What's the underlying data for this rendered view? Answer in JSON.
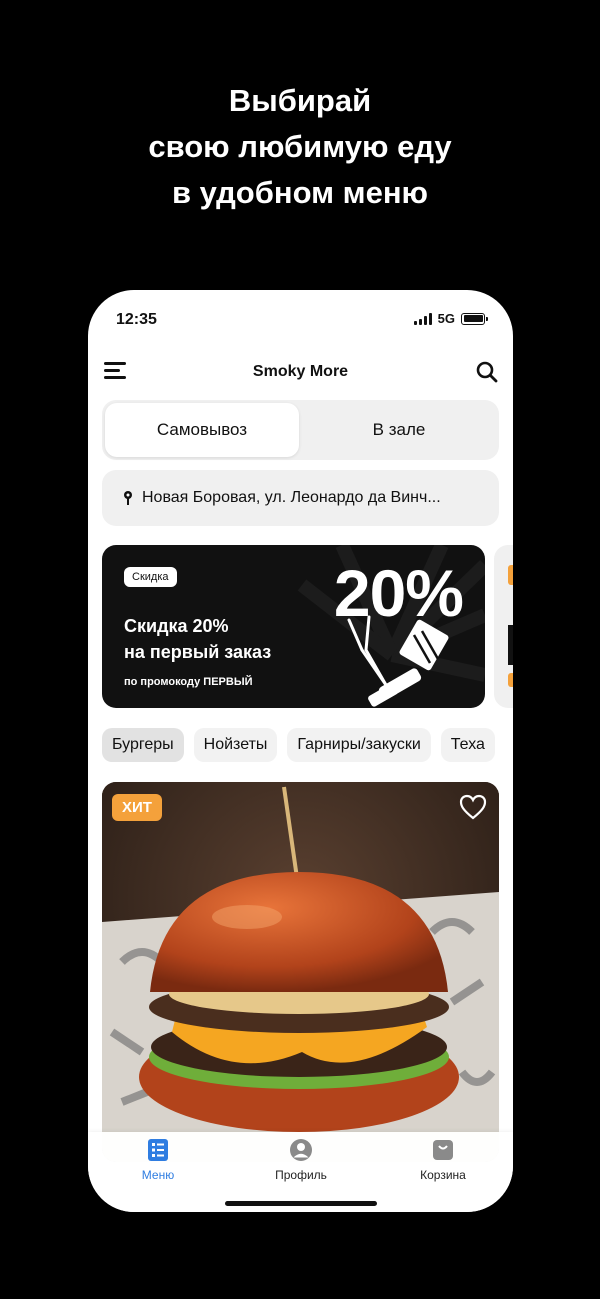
{
  "headline": {
    "line1": "Выбирай",
    "line2": "свою любимую еду",
    "line3": "в удобном меню"
  },
  "status_bar": {
    "time": "12:35",
    "network": "5G"
  },
  "app_bar": {
    "title": "Smoky More",
    "menu_icon": "hamburger-menu-icon",
    "search_icon": "search-icon"
  },
  "order_type": {
    "options": [
      "Самовывоз",
      "В зале"
    ],
    "selected": "Самовывоз"
  },
  "address": {
    "text": "Новая Боровая, ул. Леонардо да Винч..."
  },
  "promo_banner": {
    "badge": "Скидка",
    "line1": "Скидка 20%",
    "line2": "на первый заказ",
    "code_text": "по промокоду ПЕРВЫЙ",
    "percent": "20%"
  },
  "categories": [
    "Бургеры",
    "Нойзеты",
    "Гарниры/закуски",
    "Теха"
  ],
  "selected_category": "Бургеры",
  "product_card": {
    "badge": "ХИТ"
  },
  "tab_bar": {
    "items": [
      {
        "label": "Меню",
        "icon": "menu-list-icon",
        "active": true
      },
      {
        "label": "Профиль",
        "icon": "profile-icon",
        "active": false
      },
      {
        "label": "Корзина",
        "icon": "bag-icon",
        "active": false
      }
    ]
  },
  "colors": {
    "accent": "#2f7de1",
    "hit_badge": "#f4a13b",
    "banner_bg": "#111111"
  }
}
